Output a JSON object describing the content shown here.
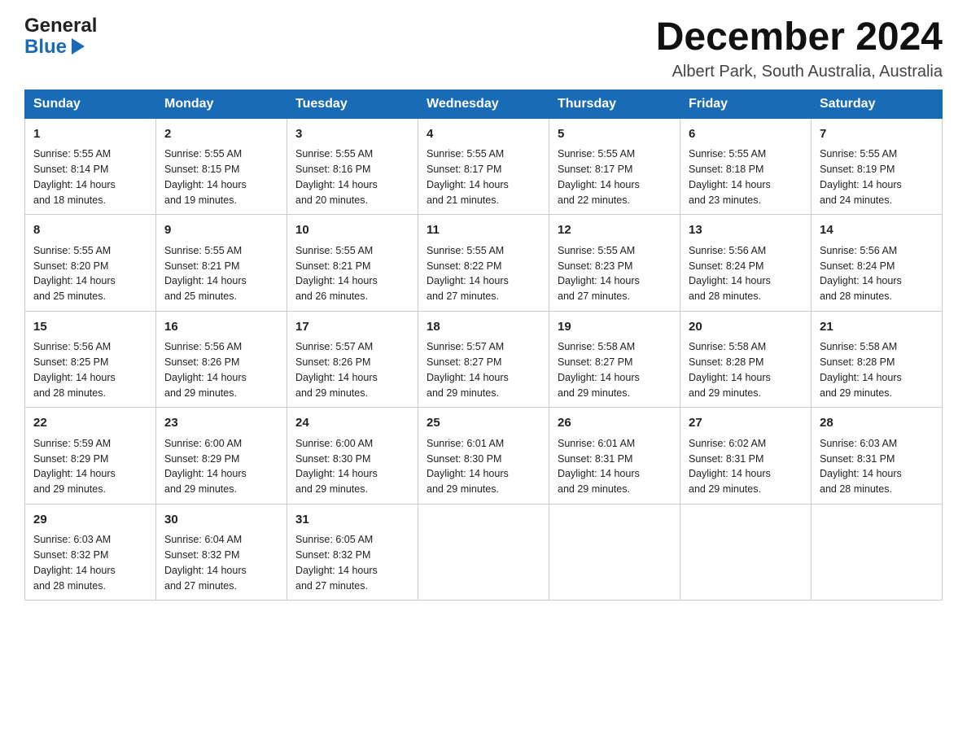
{
  "logo": {
    "line1": "General",
    "line2": "Blue"
  },
  "title": "December 2024",
  "location": "Albert Park, South Australia, Australia",
  "days_of_week": [
    "Sunday",
    "Monday",
    "Tuesday",
    "Wednesday",
    "Thursday",
    "Friday",
    "Saturday"
  ],
  "weeks": [
    [
      {
        "day": "1",
        "sunrise": "5:55 AM",
        "sunset": "8:14 PM",
        "daylight": "14 hours and 18 minutes."
      },
      {
        "day": "2",
        "sunrise": "5:55 AM",
        "sunset": "8:15 PM",
        "daylight": "14 hours and 19 minutes."
      },
      {
        "day": "3",
        "sunrise": "5:55 AM",
        "sunset": "8:16 PM",
        "daylight": "14 hours and 20 minutes."
      },
      {
        "day": "4",
        "sunrise": "5:55 AM",
        "sunset": "8:17 PM",
        "daylight": "14 hours and 21 minutes."
      },
      {
        "day": "5",
        "sunrise": "5:55 AM",
        "sunset": "8:17 PM",
        "daylight": "14 hours and 22 minutes."
      },
      {
        "day": "6",
        "sunrise": "5:55 AM",
        "sunset": "8:18 PM",
        "daylight": "14 hours and 23 minutes."
      },
      {
        "day": "7",
        "sunrise": "5:55 AM",
        "sunset": "8:19 PM",
        "daylight": "14 hours and 24 minutes."
      }
    ],
    [
      {
        "day": "8",
        "sunrise": "5:55 AM",
        "sunset": "8:20 PM",
        "daylight": "14 hours and 25 minutes."
      },
      {
        "day": "9",
        "sunrise": "5:55 AM",
        "sunset": "8:21 PM",
        "daylight": "14 hours and 25 minutes."
      },
      {
        "day": "10",
        "sunrise": "5:55 AM",
        "sunset": "8:21 PM",
        "daylight": "14 hours and 26 minutes."
      },
      {
        "day": "11",
        "sunrise": "5:55 AM",
        "sunset": "8:22 PM",
        "daylight": "14 hours and 27 minutes."
      },
      {
        "day": "12",
        "sunrise": "5:55 AM",
        "sunset": "8:23 PM",
        "daylight": "14 hours and 27 minutes."
      },
      {
        "day": "13",
        "sunrise": "5:56 AM",
        "sunset": "8:24 PM",
        "daylight": "14 hours and 28 minutes."
      },
      {
        "day": "14",
        "sunrise": "5:56 AM",
        "sunset": "8:24 PM",
        "daylight": "14 hours and 28 minutes."
      }
    ],
    [
      {
        "day": "15",
        "sunrise": "5:56 AM",
        "sunset": "8:25 PM",
        "daylight": "14 hours and 28 minutes."
      },
      {
        "day": "16",
        "sunrise": "5:56 AM",
        "sunset": "8:26 PM",
        "daylight": "14 hours and 29 minutes."
      },
      {
        "day": "17",
        "sunrise": "5:57 AM",
        "sunset": "8:26 PM",
        "daylight": "14 hours and 29 minutes."
      },
      {
        "day": "18",
        "sunrise": "5:57 AM",
        "sunset": "8:27 PM",
        "daylight": "14 hours and 29 minutes."
      },
      {
        "day": "19",
        "sunrise": "5:58 AM",
        "sunset": "8:27 PM",
        "daylight": "14 hours and 29 minutes."
      },
      {
        "day": "20",
        "sunrise": "5:58 AM",
        "sunset": "8:28 PM",
        "daylight": "14 hours and 29 minutes."
      },
      {
        "day": "21",
        "sunrise": "5:58 AM",
        "sunset": "8:28 PM",
        "daylight": "14 hours and 29 minutes."
      }
    ],
    [
      {
        "day": "22",
        "sunrise": "5:59 AM",
        "sunset": "8:29 PM",
        "daylight": "14 hours and 29 minutes."
      },
      {
        "day": "23",
        "sunrise": "6:00 AM",
        "sunset": "8:29 PM",
        "daylight": "14 hours and 29 minutes."
      },
      {
        "day": "24",
        "sunrise": "6:00 AM",
        "sunset": "8:30 PM",
        "daylight": "14 hours and 29 minutes."
      },
      {
        "day": "25",
        "sunrise": "6:01 AM",
        "sunset": "8:30 PM",
        "daylight": "14 hours and 29 minutes."
      },
      {
        "day": "26",
        "sunrise": "6:01 AM",
        "sunset": "8:31 PM",
        "daylight": "14 hours and 29 minutes."
      },
      {
        "day": "27",
        "sunrise": "6:02 AM",
        "sunset": "8:31 PM",
        "daylight": "14 hours and 29 minutes."
      },
      {
        "day": "28",
        "sunrise": "6:03 AM",
        "sunset": "8:31 PM",
        "daylight": "14 hours and 28 minutes."
      }
    ],
    [
      {
        "day": "29",
        "sunrise": "6:03 AM",
        "sunset": "8:32 PM",
        "daylight": "14 hours and 28 minutes."
      },
      {
        "day": "30",
        "sunrise": "6:04 AM",
        "sunset": "8:32 PM",
        "daylight": "14 hours and 27 minutes."
      },
      {
        "day": "31",
        "sunrise": "6:05 AM",
        "sunset": "8:32 PM",
        "daylight": "14 hours and 27 minutes."
      },
      null,
      null,
      null,
      null
    ]
  ],
  "labels": {
    "sunrise": "Sunrise:",
    "sunset": "Sunset:",
    "daylight": "Daylight:"
  }
}
